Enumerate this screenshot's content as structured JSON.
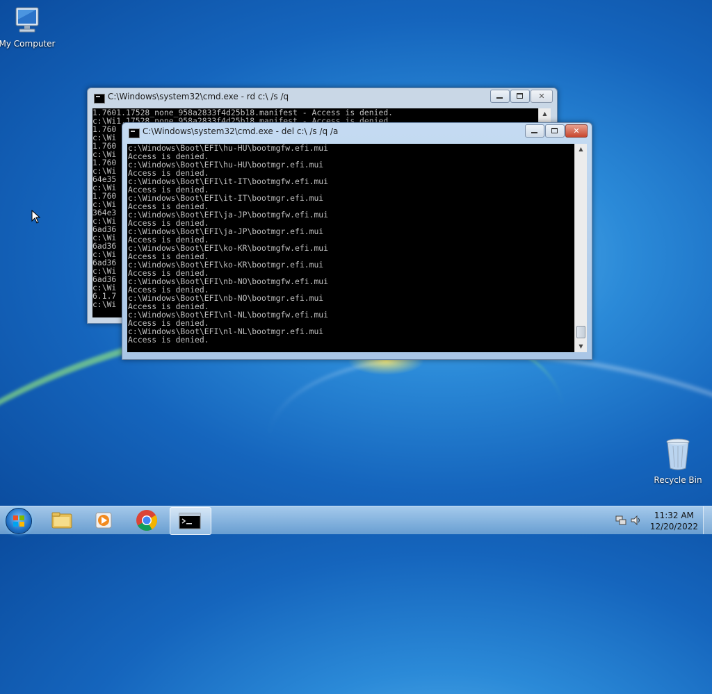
{
  "desktop": {
    "icons": [
      {
        "label": "My Computer",
        "icon": "computer-icon"
      },
      {
        "label": "Recycle Bin",
        "icon": "recycle-bin-icon"
      }
    ]
  },
  "windows": {
    "back": {
      "title": "C:\\Windows\\system32\\cmd.exe - rd  c:\\ /s /q",
      "lines": [
        "1.7601.17528_none_958a2833f4d25b18.manifest - Access is denied.",
        "c:\\Wi1.17528_none_958a2833f4d25b18.manifest - Access is denied.",
        "1.760",
        "c:\\Wi",
        "1.760",
        "c:\\Wi",
        "1.760",
        "c:\\Wi",
        "64e35",
        "c:\\Wi",
        "1.760",
        "c:\\Wi",
        "364e3",
        "c:\\Wi",
        "6ad36",
        "c:\\Wi",
        "6ad36",
        "c:\\Wi",
        "6ad36",
        "c:\\Wi",
        "6ad36",
        "c:\\Wi",
        "6.1.7",
        "c:\\Wi"
      ]
    },
    "front": {
      "title": "C:\\Windows\\system32\\cmd.exe - del  c:\\ /s /q /a",
      "lines": [
        "c:\\Windows\\Boot\\EFI\\hu-HU\\bootmgfw.efi.mui",
        "Access is denied.",
        "c:\\Windows\\Boot\\EFI\\hu-HU\\bootmgr.efi.mui",
        "Access is denied.",
        "c:\\Windows\\Boot\\EFI\\it-IT\\bootmgfw.efi.mui",
        "Access is denied.",
        "c:\\Windows\\Boot\\EFI\\it-IT\\bootmgr.efi.mui",
        "Access is denied.",
        "c:\\Windows\\Boot\\EFI\\ja-JP\\bootmgfw.efi.mui",
        "Access is denied.",
        "c:\\Windows\\Boot\\EFI\\ja-JP\\bootmgr.efi.mui",
        "Access is denied.",
        "c:\\Windows\\Boot\\EFI\\ko-KR\\bootmgfw.efi.mui",
        "Access is denied.",
        "c:\\Windows\\Boot\\EFI\\ko-KR\\bootmgr.efi.mui",
        "Access is denied.",
        "c:\\Windows\\Boot\\EFI\\nb-NO\\bootmgfw.efi.mui",
        "Access is denied.",
        "c:\\Windows\\Boot\\EFI\\nb-NO\\bootmgr.efi.mui",
        "Access is denied.",
        "c:\\Windows\\Boot\\EFI\\nl-NL\\bootmgfw.efi.mui",
        "Access is denied.",
        "c:\\Windows\\Boot\\EFI\\nl-NL\\bootmgr.efi.mui",
        "Access is denied."
      ]
    }
  },
  "taskbar": {
    "items": [
      {
        "icon": "start-button-icon"
      },
      {
        "icon": "file-explorer-icon"
      },
      {
        "icon": "media-player-icon"
      },
      {
        "icon": "chrome-icon"
      },
      {
        "icon": "command-prompt-icon",
        "active": true
      }
    ],
    "clock": {
      "time": "11:32 AM",
      "date": "12/20/2022"
    }
  }
}
